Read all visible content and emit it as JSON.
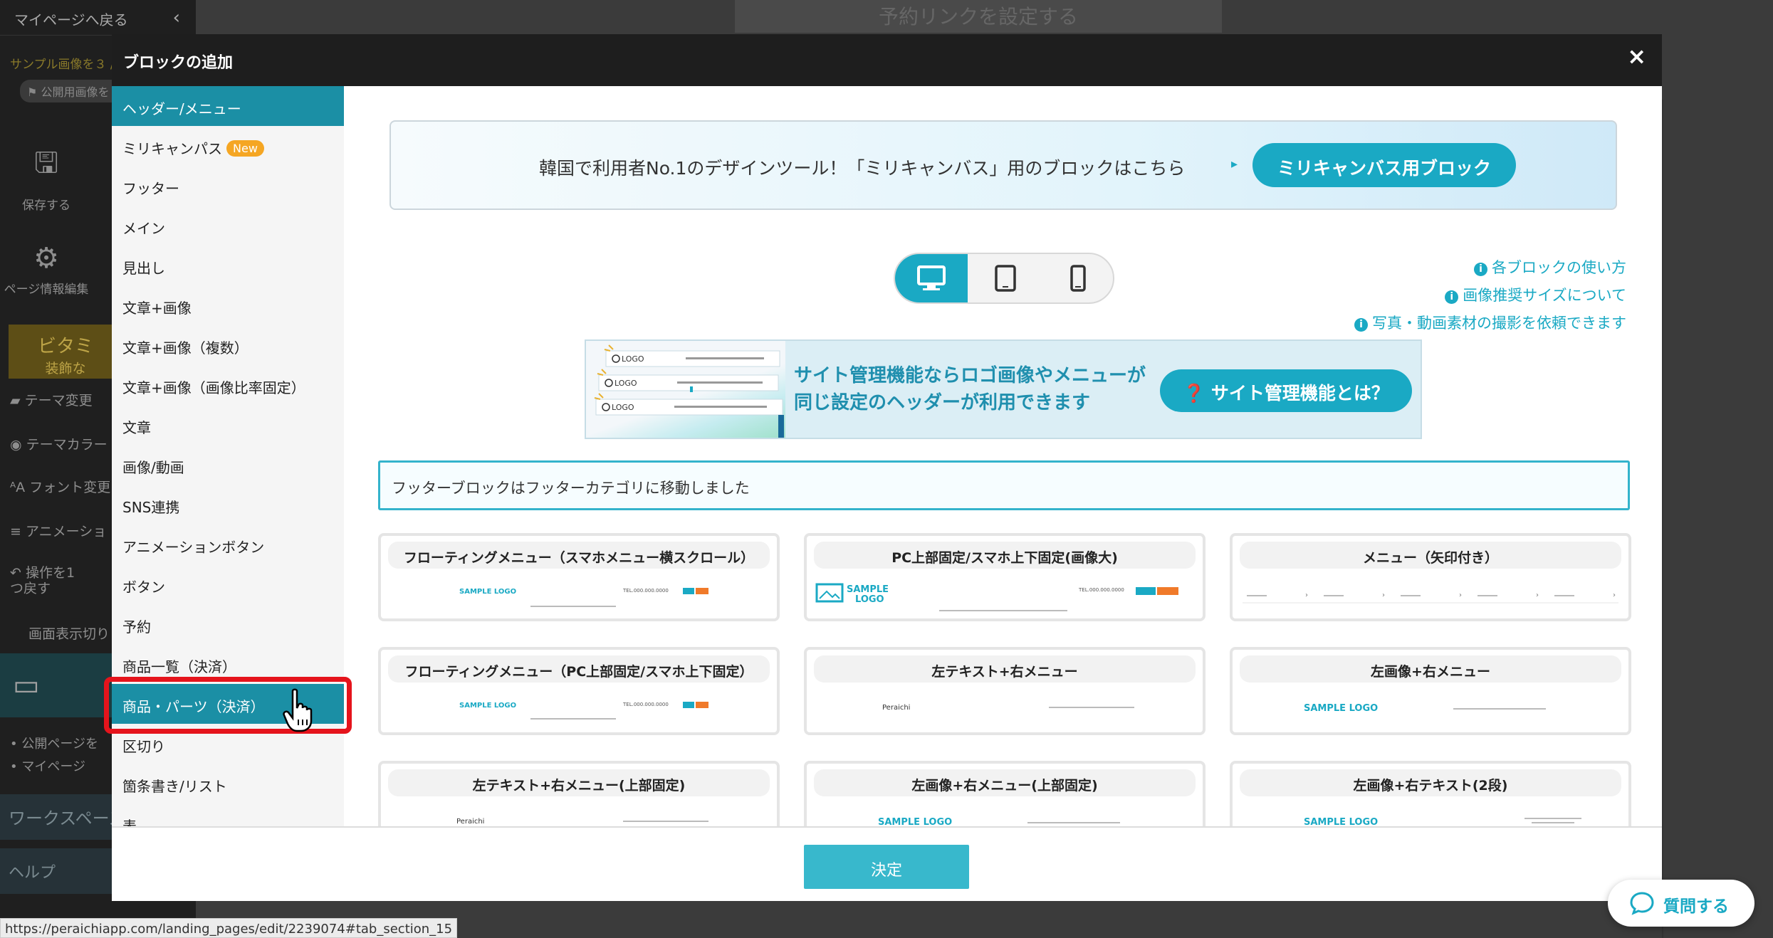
{
  "editor": {
    "back_label": "マイページへ戻る",
    "sample_note": "サンプル画像を３ /",
    "public_label": "公開用画像を",
    "save_label": "保存する",
    "page_info_label": "ページ情報編集",
    "vita_label": "ビタミ",
    "vita_sub": "装飾な",
    "menu_items": [
      "テーマ変更",
      "テーマカラー",
      "フォント変更",
      "アニメーショ"
    ],
    "undo_label": "操作を1つ戻す",
    "display_switch": "画面表示切り",
    "links": [
      "公開ページを",
      "マイページ"
    ],
    "workspace_label": "ワークスペース",
    "help_label": "ヘルプ",
    "top_button": "予約リンクを設定する"
  },
  "modal": {
    "title": "ブロックの追加",
    "close_label": "×",
    "categories": [
      "ヘッダー/メニュー",
      "ミリキャンパス",
      "フッター",
      "メイン",
      "見出し",
      "文章+画像",
      "文章+画像（複数）",
      "文章+画像（画像比率固定）",
      "文章",
      "画像/動画",
      "SNS連携",
      "アニメーションボタン",
      "ボタン",
      "予約",
      "商品一覧（決済）",
      "商品・パーツ（決済）",
      "区切り",
      "箇条書き/リスト",
      "表"
    ],
    "new_badge": "New",
    "active_category": "ヘッダー/メニュー",
    "banner_text": "韓国で利用者No.1のデザインツール！「ミリキャンバス」用のブロックはこちら",
    "banner_button": "ミリキャンバス用ブロック",
    "help_links": [
      "各ブロックの使い方",
      "画像推奨サイズについて",
      "写真・動画素材の撮影を依頼できます"
    ],
    "promo_line1": "サイト管理機能ならロゴ画像やメニューが",
    "promo_line2": "同じ設定のヘッダーが利用できます",
    "promo_button": "サイト管理機能とは？",
    "notice": "フッターブロックはフッターカテゴリに移動しました",
    "cards": [
      "フローティングメニュー（スマホメニュー横スクロール）",
      "PC上部固定/スマホ上下固定(画像大)",
      "メニュー（矢印付き）",
      "フローティングメニュー（PC上部固定/スマホ上下固定）",
      "左テキスト+右メニュー",
      "左画像+右メニュー",
      "左テキスト+右メニュー(上部固定)",
      "左画像+右メニュー(上部固定)",
      "左画像+右テキスト(2段)"
    ],
    "preview_texts": {
      "sample_logo": "SAMPLE LOGO",
      "logo": "LOGO",
      "tel": "TEL.000.000.0000",
      "peraichi": "Peraichi",
      "menu": "メニュー"
    },
    "confirm_button": "決定"
  },
  "status_url": "https://peraichiapp.com/landing_pages/edit/2239074#tab_section_15",
  "chat_button": "質問する",
  "colors": {
    "accent": "#1aa9c4",
    "active_category": "#1b8fa5",
    "highlight": "#e5141c",
    "new_badge": "#f5a623"
  }
}
